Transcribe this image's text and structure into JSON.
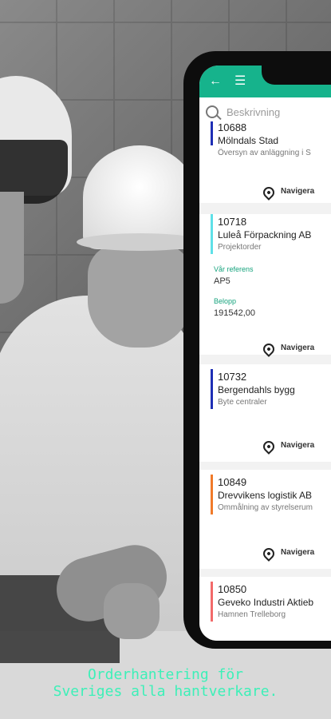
{
  "tagline": [
    "Orderhantering för",
    "Sveriges alla hantverkare."
  ],
  "app": {
    "search_placeholder": "Beskrivning",
    "colors": {
      "appbar": "#16b38c",
      "accent_label": "#16a37d"
    }
  },
  "orders": [
    {
      "number": "10688",
      "customer": "Mölndals Stad",
      "description": "Översyn av anläggning i S",
      "bar_color": "#1f2fb5",
      "navigate_label": "Navigera"
    },
    {
      "number": "10718",
      "customer": "Luleå Förpackning AB",
      "description": "Projektorder",
      "bar_color": "#5fe0e8",
      "reference_label": "Vår referens",
      "reference": "AP5",
      "amount_label": "Belopp",
      "amount": "191542,00",
      "navigate_label": "Navigera"
    },
    {
      "number": "10732",
      "customer": "Bergendahls bygg",
      "description": "Byte centraler",
      "bar_color": "#1f2fb5",
      "navigate_label": "Navigera"
    },
    {
      "number": "10849",
      "customer": "Drevvikens logistik AB",
      "description": "Ommålning av styrelserum",
      "bar_color": "#f07a2a",
      "navigate_label": "Navigera"
    },
    {
      "number": "10850",
      "customer": "Geveko Industri Aktieb",
      "description": "Hamnen Trelleborg",
      "bar_color": "#f26a6a"
    }
  ]
}
